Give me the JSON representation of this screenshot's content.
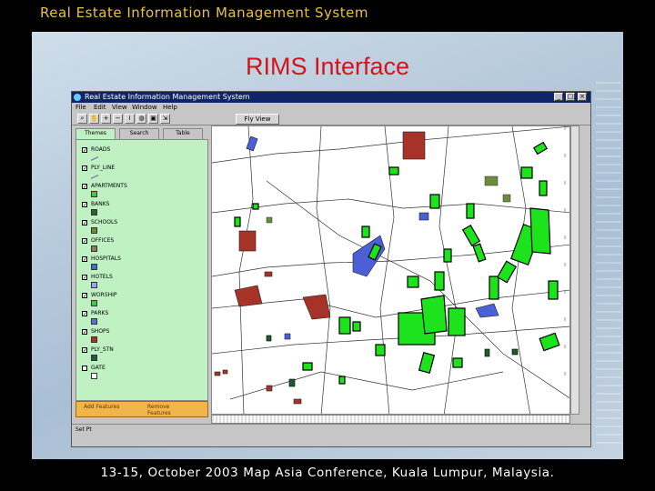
{
  "slide": {
    "header": "Real Estate Information Management System",
    "title": "RIMS Interface",
    "footer": "13-15, October 2003 Map Asia Conference, Kuala Lumpur, Malaysia."
  },
  "window": {
    "title": "Real Estate Information Management System",
    "controls": [
      "_",
      "□",
      "×"
    ],
    "menu": [
      "File",
      "Edit",
      "View",
      "Window",
      "Help"
    ],
    "toolbar_button": "Fly View"
  },
  "tabs": [
    "Themes",
    "Search",
    "Table"
  ],
  "layers": [
    {
      "name": "ROADS",
      "type": "line",
      "color": "#5555aa"
    },
    {
      "name": "PLY_LINE",
      "type": "line",
      "color": "#5555aa"
    },
    {
      "name": "APARTMENTS",
      "type": "fill",
      "color": "#3ecf3e"
    },
    {
      "name": "BANKS",
      "type": "fill",
      "color": "#1f6a2a"
    },
    {
      "name": "SCHOOLS",
      "type": "fill",
      "color": "#6b8c3a"
    },
    {
      "name": "OFFICES",
      "type": "fill",
      "color": "#8a7b5c"
    },
    {
      "name": "HOSPITALS",
      "type": "fill",
      "color": "#3b6fd1"
    },
    {
      "name": "HOTELS",
      "type": "fill",
      "color": "#9aa3ff"
    },
    {
      "name": "WORSHIP",
      "type": "fill",
      "color": "#3ecf3e"
    },
    {
      "name": "PARKS",
      "type": "fill",
      "color": "#5a6fd8"
    },
    {
      "name": "SHOPS",
      "type": "fill",
      "color": "#b52d25"
    },
    {
      "name": "PLY_STN",
      "type": "fill",
      "color": "#235a3a"
    },
    {
      "name": "GATE",
      "type": "fill",
      "color": "#ffffff"
    }
  ],
  "feature_buttons": {
    "add": "Add Features",
    "remove": "Remove Features"
  },
  "status": "Set Pt",
  "colors": {
    "apartment": "#1de31d",
    "shop": "#a63228",
    "park": "#4b5fd6",
    "bank": "#1b5d2c",
    "roads": "#3a3a3a"
  }
}
